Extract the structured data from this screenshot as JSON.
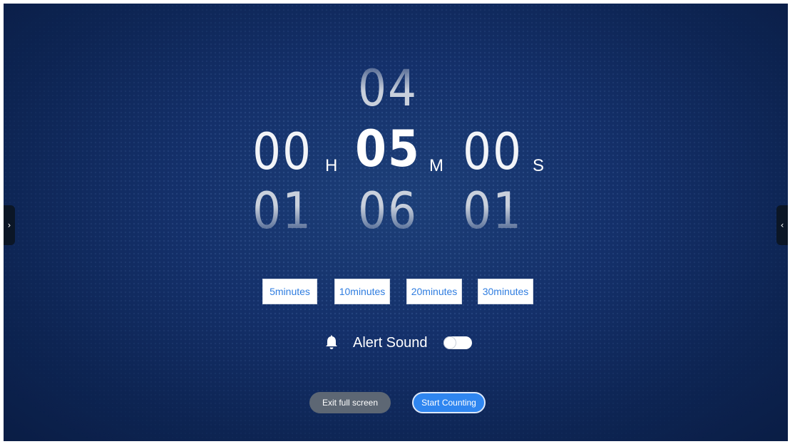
{
  "timer": {
    "hours": {
      "prev": "",
      "current": "00",
      "next": "01",
      "unit": "H"
    },
    "minutes": {
      "prev": "04",
      "current": "05",
      "next": "06",
      "unit": "M"
    },
    "seconds": {
      "prev": "",
      "current": "00",
      "next": "01",
      "unit": "S"
    }
  },
  "presets": [
    "5minutes",
    "10minutes",
    "20minutes",
    "30minutes"
  ],
  "alert": {
    "label": "Alert Sound",
    "enabled": false
  },
  "buttons": {
    "exit": "Exit full screen",
    "start": "Start Counting"
  },
  "side_tabs": {
    "left": "›",
    "right": "‹"
  },
  "colors": {
    "accent": "#2f86f0",
    "preset_text": "#2f7de0",
    "exit_bg": "#5d6774"
  }
}
